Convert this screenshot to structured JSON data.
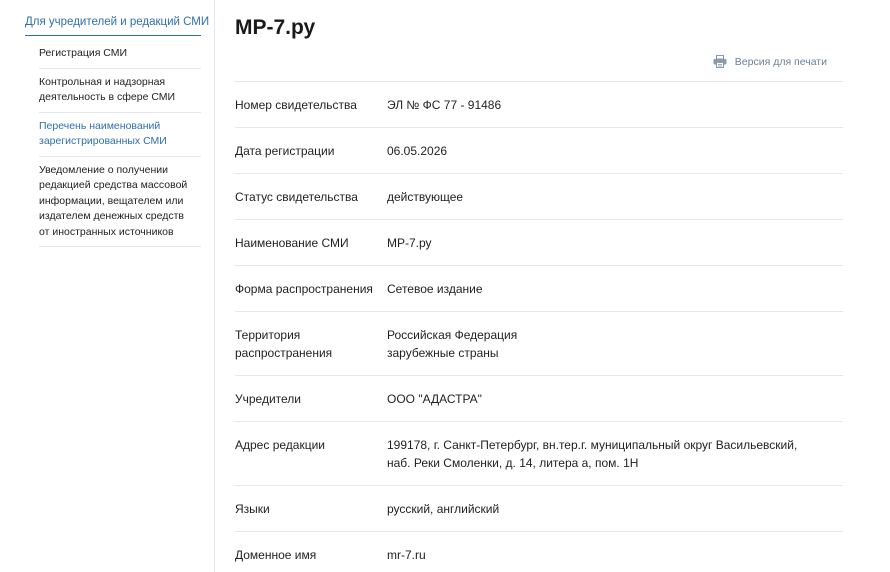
{
  "sidebar": {
    "header": "Для учредителей и редакций СМИ",
    "items": [
      {
        "lines": [
          "Регистрация СМИ"
        ]
      },
      {
        "lines": [
          "Контрольная и надзорная",
          "деятельность в сфере СМИ"
        ]
      },
      {
        "lines": [
          "Перечень наименований",
          "зарегистрированных СМИ"
        ],
        "active": true
      },
      {
        "lines": [
          "Уведомление о получении",
          "редакцией средства массовой",
          "информации, вещателем или",
          "издателем денежных средств",
          "от иностранных источников"
        ]
      }
    ]
  },
  "main": {
    "title": "МР-7.ру",
    "print_label": "Версия для печати",
    "rows": [
      {
        "label": [
          "Номер свидетельства"
        ],
        "value": [
          "ЭЛ № ФС 77 - 91486"
        ]
      },
      {
        "label": [
          "Дата регистрации"
        ],
        "value": [
          "06.05.2026"
        ]
      },
      {
        "label": [
          "Статус свидетельства"
        ],
        "value": [
          "действующее"
        ]
      },
      {
        "label": [
          "Наименование СМИ"
        ],
        "value": [
          "МР-7.ру"
        ]
      },
      {
        "label": [
          "Форма распространения"
        ],
        "value": [
          "Сетевое издание"
        ]
      },
      {
        "label": [
          "Территория",
          "распространения"
        ],
        "value": [
          "Российская Федерация",
          "зарубежные страны"
        ]
      },
      {
        "label": [
          "Учредители"
        ],
        "value": [
          "ООО \"АДАСТРА\""
        ]
      },
      {
        "label": [
          "Адрес редакции"
        ],
        "value": [
          "199178, г. Санкт-Петербург, вн.тер.г. муниципальный округ Васильевский,",
          "наб. Реки Смоленки, д. 14, литера а, пом. 1Н"
        ]
      },
      {
        "label": [
          "Языки"
        ],
        "value": [
          "русский, английский"
        ]
      },
      {
        "label": [
          "Доменное имя"
        ],
        "value": [
          "mr-7.ru"
        ]
      }
    ]
  },
  "colors": {
    "accent": "#2f6fae",
    "divider": "#e3e6ea",
    "muted": "#6b7f92"
  },
  "icons": {
    "print": "printer-icon"
  }
}
